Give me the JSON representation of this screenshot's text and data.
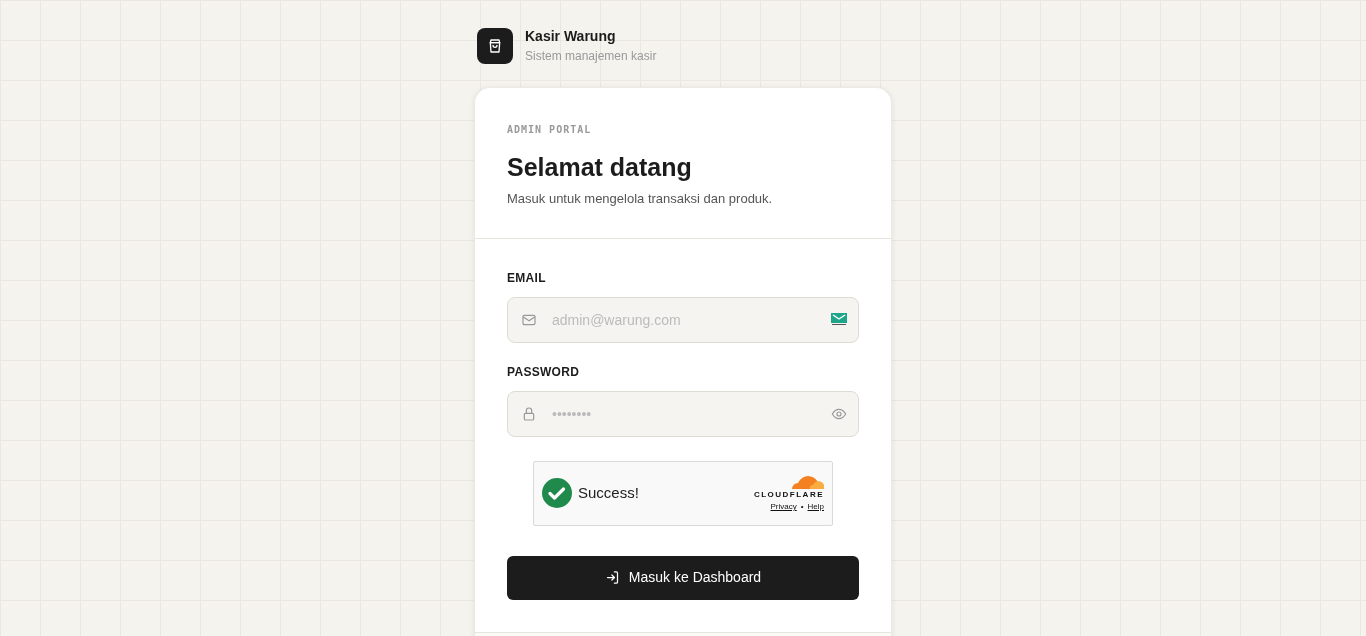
{
  "brand": {
    "name": "Kasir Warung",
    "tagline": "Sistem manajemen kasir"
  },
  "card": {
    "eyebrow": "ADMIN PORTAL",
    "title": "Selamat datang",
    "subtitle": "Masuk untuk mengelola transaksi dan produk."
  },
  "fields": [
    {
      "kind": "email",
      "label": "EMAIL",
      "placeholder": "admin@warung.com"
    },
    {
      "kind": "password",
      "label": "PASSWORD",
      "placeholder": "••••••••"
    }
  ],
  "captcha": {
    "status": "Success!",
    "provider": "CLOUDFLARE",
    "links": [
      "Privacy",
      "Help"
    ],
    "separator": "•"
  },
  "submit": {
    "label": "Masuk ke Dashboard"
  }
}
